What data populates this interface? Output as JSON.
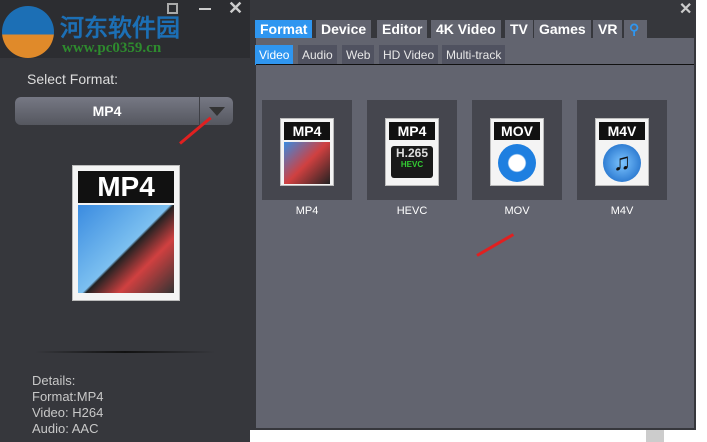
{
  "watermark": {
    "name": "河东软件园",
    "url": "www.pc0359.cn"
  },
  "left": {
    "select_label": "Select Format:",
    "selected": "MP4",
    "preview_label": "MP4",
    "details": [
      "Details:",
      "Format:MP4",
      "Video: H264",
      "Audio: AAC"
    ]
  },
  "tabs": [
    "Format",
    "Device",
    "Editor",
    "4K Video",
    "TV",
    "Games",
    "VR"
  ],
  "subtabs": [
    "Video",
    "Audio",
    "Web",
    "HD Video",
    "Multi-track"
  ],
  "formats": [
    {
      "label": "MP4",
      "head": "MP4"
    },
    {
      "label": "HEVC",
      "head": "MP4",
      "badge": "H.265",
      "badge2": "HEVC"
    },
    {
      "label": "MOV",
      "head": "MOV"
    },
    {
      "label": "M4V",
      "head": "M4V"
    }
  ],
  "colors": {
    "accent": "#2f96f0",
    "panel": "#36373c",
    "content": "#62646f"
  }
}
